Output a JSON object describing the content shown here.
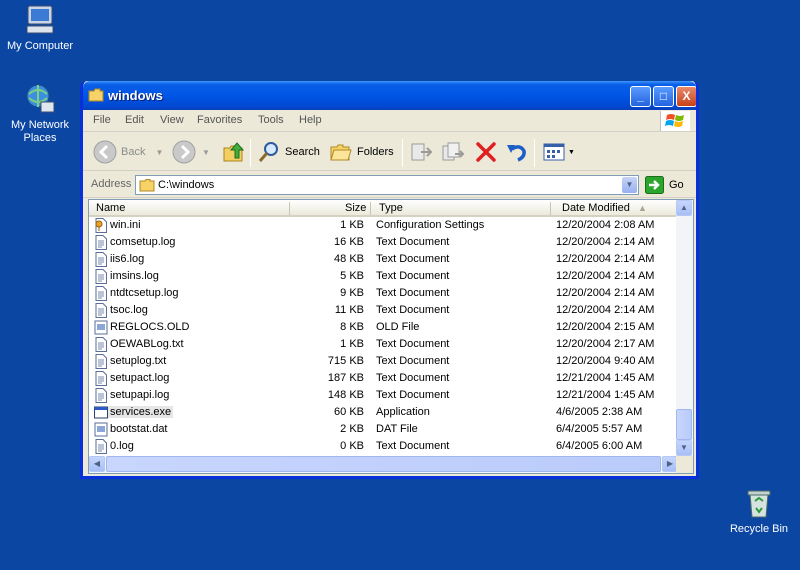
{
  "desktop": {
    "icons": [
      {
        "label": "My Computer",
        "icon": "my-computer-icon"
      },
      {
        "label": "My Network Places",
        "icon": "network-places-icon"
      },
      {
        "label": "Recycle Bin",
        "icon": "recycle-bin-icon"
      }
    ],
    "background_color": "#0b46a3"
  },
  "window": {
    "title": "windows",
    "controls": {
      "minimize": "_",
      "maximize": "□",
      "close": "X"
    },
    "menu": [
      "File",
      "Edit",
      "View",
      "Favorites",
      "Tools",
      "Help"
    ],
    "toolbar": {
      "back_label": "Back",
      "search_label": "Search",
      "folders_label": "Folders"
    },
    "address": {
      "label": "Address",
      "value": "C:\\windows",
      "go_label": "Go"
    },
    "list": {
      "columns": {
        "name": "Name",
        "size": "Size",
        "type": "Type",
        "date": "Date Modified"
      },
      "sort": "Date Modified ascending",
      "rows": [
        {
          "name": "win.ini",
          "size": "1 KB",
          "type": "Configuration Settings",
          "date": "12/20/2004 2:08 AM",
          "icon": "settings-file-icon"
        },
        {
          "name": "comsetup.log",
          "size": "16 KB",
          "type": "Text Document",
          "date": "12/20/2004 2:14 AM",
          "icon": "text-document-icon"
        },
        {
          "name": "iis6.log",
          "size": "48 KB",
          "type": "Text Document",
          "date": "12/20/2004 2:14 AM",
          "icon": "text-document-icon"
        },
        {
          "name": "imsins.log",
          "size": "5 KB",
          "type": "Text Document",
          "date": "12/20/2004 2:14 AM",
          "icon": "text-document-icon"
        },
        {
          "name": "ntdtcsetup.log",
          "size": "9 KB",
          "type": "Text Document",
          "date": "12/20/2004 2:14 AM",
          "icon": "text-document-icon"
        },
        {
          "name": "tsoc.log",
          "size": "11 KB",
          "type": "Text Document",
          "date": "12/20/2004 2:14 AM",
          "icon": "text-document-icon"
        },
        {
          "name": "REGLOCS.OLD",
          "size": "8 KB",
          "type": "OLD File",
          "date": "12/20/2004 2:15 AM",
          "icon": "generic-file-icon"
        },
        {
          "name": "OEWABLog.txt",
          "size": "1 KB",
          "type": "Text Document",
          "date": "12/20/2004 2:17 AM",
          "icon": "text-document-icon"
        },
        {
          "name": "setuplog.txt",
          "size": "715 KB",
          "type": "Text Document",
          "date": "12/20/2004 9:40 AM",
          "icon": "text-document-icon"
        },
        {
          "name": "setupact.log",
          "size": "187 KB",
          "type": "Text Document",
          "date": "12/21/2004 1:45 AM",
          "icon": "text-document-icon"
        },
        {
          "name": "setupapi.log",
          "size": "148 KB",
          "type": "Text Document",
          "date": "12/21/2004 1:45 AM",
          "icon": "text-document-icon"
        },
        {
          "name": "services.exe",
          "size": "60 KB",
          "type": "Application",
          "date": "4/6/2005 2:38 AM",
          "icon": "application-icon",
          "selected": true
        },
        {
          "name": "bootstat.dat",
          "size": "2 KB",
          "type": "DAT File",
          "date": "6/4/2005 5:57 AM",
          "icon": "generic-file-icon"
        },
        {
          "name": "0.log",
          "size": "0 KB",
          "type": "Text Document",
          "date": "6/4/2005 6:00 AM",
          "icon": "text-document-icon"
        }
      ]
    }
  },
  "colors": {
    "titlebar": "#0055e5",
    "window_face": "#ece9d8",
    "close_button": "#c8411a",
    "delete_x": "#e02020",
    "go_green": "#2ba52b"
  }
}
